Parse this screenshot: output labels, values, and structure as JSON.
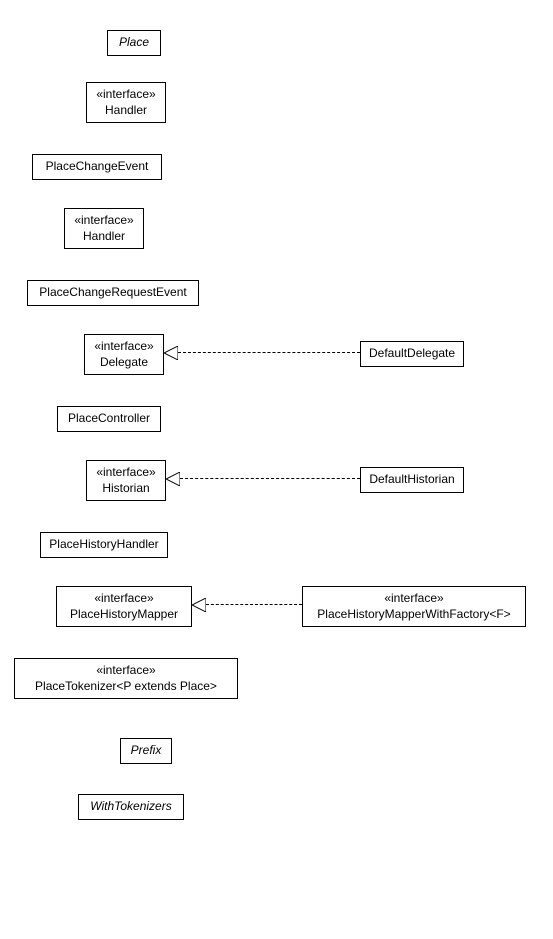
{
  "nodes": {
    "place": {
      "label": "Place",
      "italic": true
    },
    "handler1": {
      "stereo": "«interface»",
      "label": "Handler"
    },
    "placeChangeEvent": {
      "label": "PlaceChangeEvent"
    },
    "handler2": {
      "stereo": "«interface»",
      "label": "Handler"
    },
    "placeChangeRequestEvent": {
      "label": "PlaceChangeRequestEvent"
    },
    "delegate": {
      "stereo": "«interface»",
      "label": "Delegate"
    },
    "defaultDelegate": {
      "label": "DefaultDelegate"
    },
    "placeController": {
      "label": "PlaceController"
    },
    "historian": {
      "stereo": "«interface»",
      "label": "Historian"
    },
    "defaultHistorian": {
      "label": "DefaultHistorian"
    },
    "placeHistoryHandler": {
      "label": "PlaceHistoryHandler"
    },
    "placeHistoryMapper": {
      "stereo": "«interface»",
      "label": "PlaceHistoryMapper"
    },
    "placeHistoryMapperWithFactory": {
      "stereo": "«interface»",
      "label": "PlaceHistoryMapperWithFactory<F>"
    },
    "placeTokenizer": {
      "stereo": "«interface»",
      "label": "PlaceTokenizer<P extends Place>"
    },
    "prefix": {
      "label": "Prefix",
      "italic": true
    },
    "withTokenizers": {
      "label": "WithTokenizers",
      "italic": true
    }
  },
  "chart_data": {
    "type": "uml-class-diagram",
    "relations": [
      {
        "from": "DefaultDelegate",
        "to": "Delegate",
        "kind": "realization"
      },
      {
        "from": "DefaultHistorian",
        "to": "Historian",
        "kind": "realization"
      },
      {
        "from": "PlaceHistoryMapperWithFactory<F>",
        "to": "PlaceHistoryMapper",
        "kind": "realization"
      }
    ],
    "elements": [
      "Place",
      "Handler",
      "PlaceChangeEvent",
      "Handler",
      "PlaceChangeRequestEvent",
      "Delegate",
      "DefaultDelegate",
      "PlaceController",
      "Historian",
      "DefaultHistorian",
      "PlaceHistoryHandler",
      "PlaceHistoryMapper",
      "PlaceHistoryMapperWithFactory<F>",
      "PlaceTokenizer<P extends Place>",
      "Prefix",
      "WithTokenizers"
    ]
  }
}
